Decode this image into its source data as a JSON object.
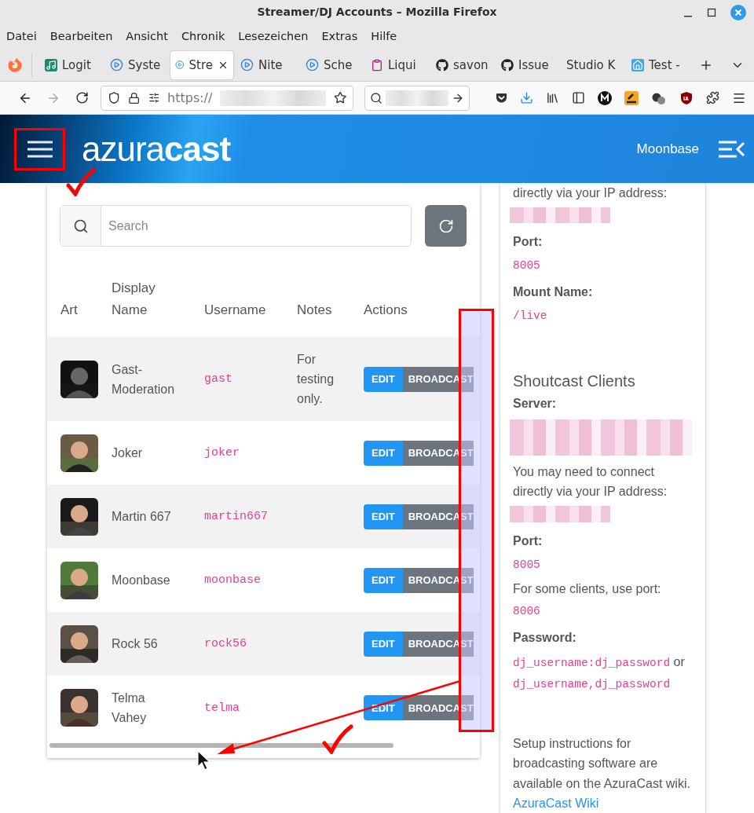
{
  "window": {
    "title": "Streamer/DJ Accounts – Mozilla Firefox"
  },
  "menu": [
    "Datei",
    "Bearbeiten",
    "Ansicht",
    "Chronik",
    "Lesezeichen",
    "Extras",
    "Hilfe"
  ],
  "tabs": [
    {
      "label": "Logit",
      "kind": "music",
      "selected": false
    },
    {
      "label": "Syste",
      "kind": "play",
      "selected": false
    },
    {
      "label": "Stre",
      "kind": "play",
      "selected": true
    },
    {
      "label": "Nite",
      "kind": "play",
      "selected": false
    },
    {
      "label": "Sche",
      "kind": "play",
      "selected": false
    },
    {
      "label": "Liqui",
      "kind": "clipboard",
      "selected": false
    },
    {
      "label": "savon",
      "kind": "github",
      "selected": false
    },
    {
      "label": "Issue",
      "kind": "github",
      "selected": false
    },
    {
      "label": "Studio K",
      "kind": "none",
      "selected": false
    },
    {
      "label": "Test -",
      "kind": "home",
      "selected": false
    }
  ],
  "address_bar": {
    "value": "https://"
  },
  "header": {
    "logo": "azura**cast**",
    "station": "Moonbase"
  },
  "search": {
    "placeholder": "Search"
  },
  "table": {
    "columns": [
      "Art",
      "Display Name",
      "Username",
      "Notes",
      "Actions"
    ],
    "rows": [
      {
        "display_name": "Gast-Moderation",
        "username": "gast",
        "notes": "For testing only.",
        "actions": [
          "EDIT",
          "BROADCAST"
        ]
      },
      {
        "display_name": "Joker",
        "username": "joker",
        "actions": [
          "EDIT",
          "BROADCAST"
        ]
      },
      {
        "display_name": "Martin 667",
        "username": "martin667",
        "actions": [
          "EDIT",
          "BROADCAST"
        ]
      },
      {
        "display_name": "Moonbase",
        "username": "moonbase",
        "actions": [
          "EDIT",
          "BROADCAST"
        ]
      },
      {
        "display_name": "Rock 56",
        "username": "rock56",
        "actions": [
          "EDIT",
          "BROADCAST"
        ]
      },
      {
        "display_name": "Telma Vahey",
        "username": "telma",
        "actions": [
          "EDIT",
          "BROADCAST"
        ]
      }
    ]
  },
  "connection_info": [
    {
      "kind": "text",
      "text": "directly via your IP address:"
    },
    {
      "kind": "redacted"
    },
    {
      "kind": "label",
      "text": "Port:"
    },
    {
      "kind": "code",
      "text": "8005"
    },
    {
      "kind": "label",
      "text": "Mount Name:"
    },
    {
      "kind": "code",
      "text": "/live"
    },
    {
      "kind": "heading",
      "text": "Shoutcast Clients"
    },
    {
      "kind": "label",
      "text": "Server:"
    },
    {
      "kind": "redacted_long"
    },
    {
      "kind": "text",
      "text": "You may need to connect directly via your IP address:"
    },
    {
      "kind": "redacted"
    },
    {
      "kind": "label",
      "text": "Port:"
    },
    {
      "kind": "code",
      "text": "8005"
    },
    {
      "kind": "text",
      "text": "For some clients, use port:"
    },
    {
      "kind": "code",
      "text": "8006"
    },
    {
      "kind": "label",
      "text": "Password:"
    },
    {
      "kind": "mixed",
      "parts": [
        {
          "kind": "code",
          "text": "dj_username:dj_password"
        },
        {
          "kind": "text",
          "text": " or "
        },
        {
          "kind": "code",
          "text": "dj_username,dj_password"
        }
      ]
    },
    {
      "kind": "note",
      "text": "Setup instructions for broadcasting software are available on the AzuraCast wiki."
    },
    {
      "kind": "link",
      "text": "AzuraCast Wiki"
    }
  ]
}
